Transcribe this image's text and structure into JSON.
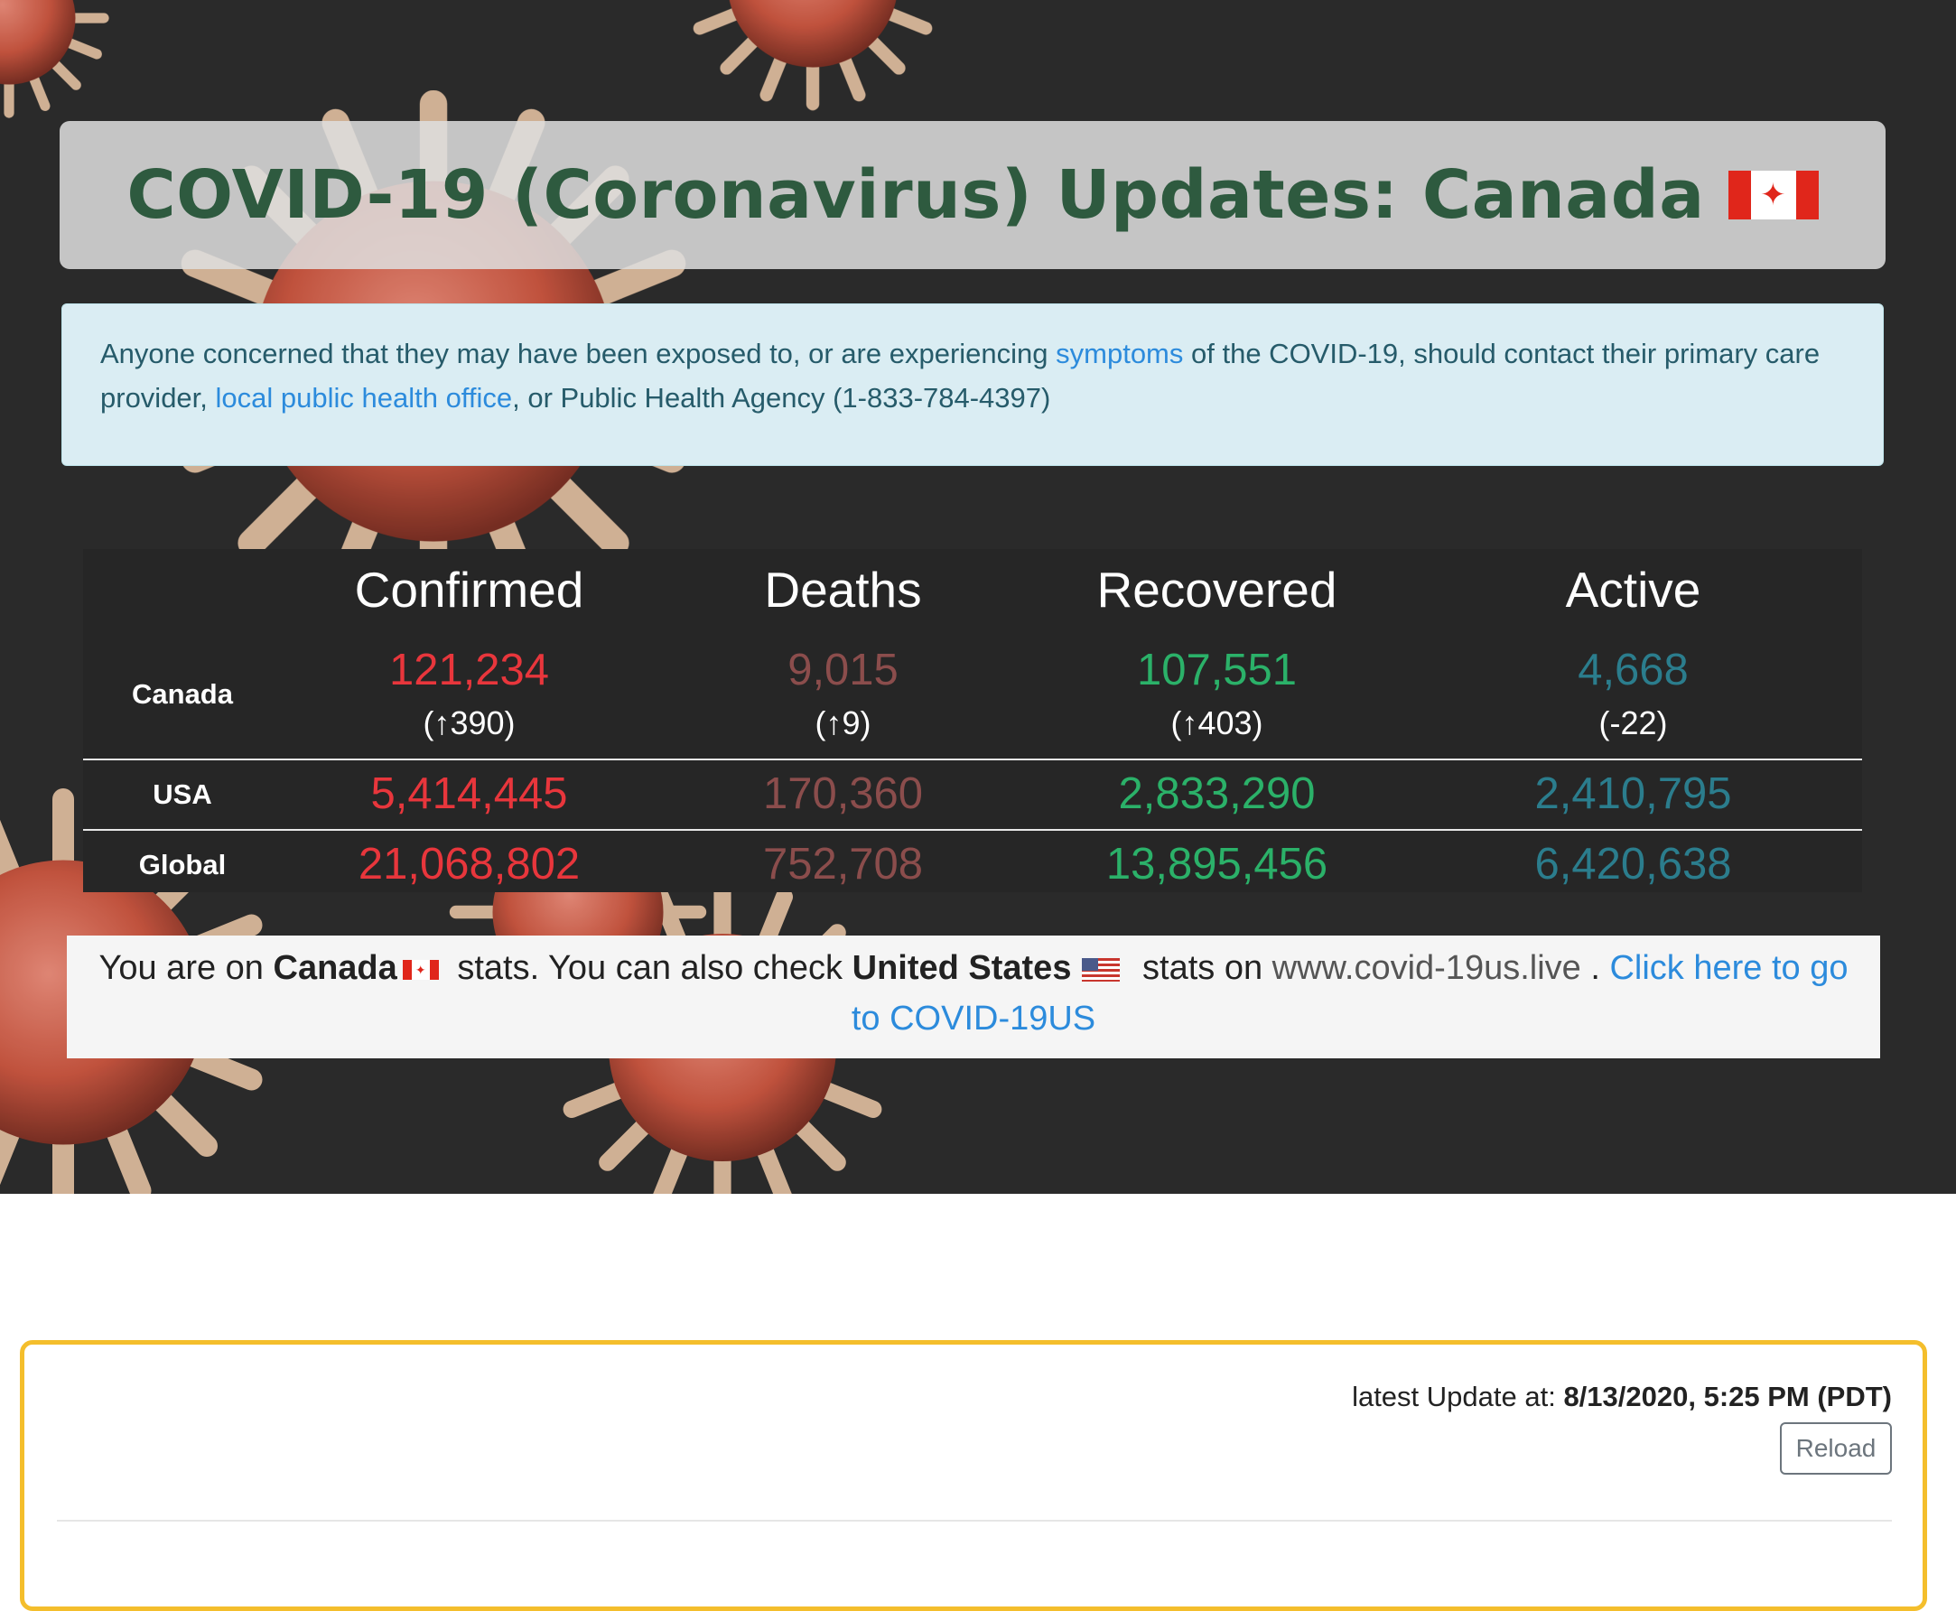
{
  "header": {
    "title": "COVID-19 (Coronavirus) Updates: Canada"
  },
  "alert": {
    "text_1": "Anyone concerned that they may have been exposed to, or are experiencing ",
    "link_symptoms": "symptoms",
    "text_2": " of the COVID-19, should contact their primary care provider, ",
    "link_health_office": "local public health office",
    "text_3": ", or Public Health Agency (1-833-784-4397)"
  },
  "stats": {
    "columns": [
      "Confirmed",
      "Deaths",
      "Recovered",
      "Active"
    ],
    "rows": [
      {
        "label": "Canada",
        "confirmed": "121,234",
        "deaths": "9,015",
        "recovered": "107,551",
        "active": "4,668",
        "confirmed_change": "(↑390)",
        "deaths_change": "(↑9)",
        "recovered_change": "(↑403)",
        "active_change": "(-22)"
      },
      {
        "label": "USA",
        "confirmed": "5,414,445",
        "deaths": "170,360",
        "recovered": "2,833,290",
        "active": "2,410,795"
      },
      {
        "label": "Global",
        "confirmed": "21,068,802",
        "deaths": "752,708",
        "recovered": "13,895,456",
        "active": "6,420,638"
      }
    ],
    "colors": {
      "confirmed": "#e8363c",
      "deaths": "#8b4d4c",
      "recovered": "#2bb169",
      "active": "#2b7d8d"
    }
  },
  "notice": {
    "text_1": "You are on ",
    "country_current": "Canada",
    "text_2": " stats. You can also check ",
    "country_other": "United States",
    "text_3": " stats on ",
    "site": "www.covid-19us.live",
    "text_4": " . ",
    "link": "Click here to go to COVID-19US"
  },
  "update": {
    "label": "latest Update at: ",
    "timestamp": "8/13/2020, 5:25 PM (PDT)",
    "reload_label": "Reload"
  },
  "icons": {
    "canada_flag": "canada-flag-icon",
    "us_flag": "us-flag-icon"
  }
}
